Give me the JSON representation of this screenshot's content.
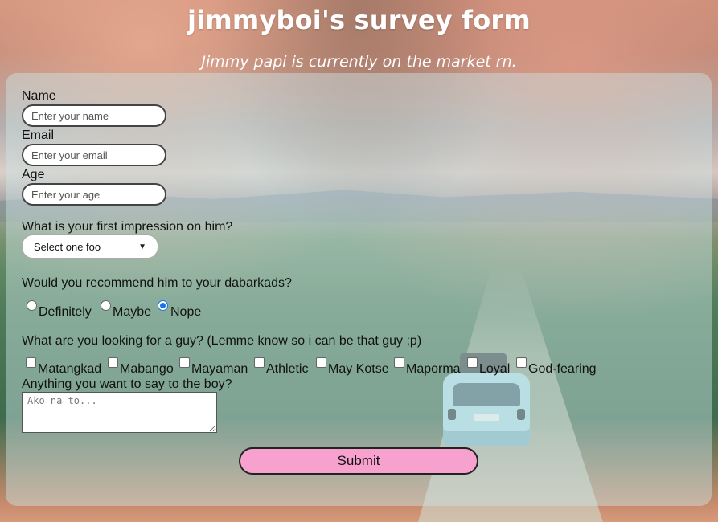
{
  "header": {
    "title": "jimmyboi's survey form",
    "subtitle": "Jimmy papi is currently on the market rn."
  },
  "form": {
    "name": {
      "label": "Name",
      "placeholder": "Enter your name",
      "value": ""
    },
    "email": {
      "label": "Email",
      "placeholder": "Enter your email",
      "value": ""
    },
    "age": {
      "label": "Age",
      "placeholder": "Enter your age",
      "value": ""
    },
    "impression": {
      "label": "What is your first impression on him?",
      "selected": "Select one foo"
    },
    "recommend": {
      "label": "Would you recommend him to your dabarkads?",
      "options": [
        "Definitely",
        "Maybe",
        "Nope"
      ],
      "selected": "Nope"
    },
    "looking_for": {
      "label": "What are you looking for a guy? (Lemme know so i can be that guy ;p)",
      "options": [
        "Matangkad",
        "Mabango",
        "Mayaman",
        "Athletic",
        "May Kotse",
        "Maporma",
        "Loyal",
        "God-fearing"
      ]
    },
    "message": {
      "label": "Anything you want to say to the boy?",
      "placeholder": "Ako na to..."
    },
    "submit_label": "Submit"
  },
  "colors": {
    "submit_bg": "#f7a1ce",
    "radio_accent": "#1a73e8",
    "title_color": "#ffffff"
  },
  "icons": {
    "select_arrow": "chevron-down-icon"
  }
}
